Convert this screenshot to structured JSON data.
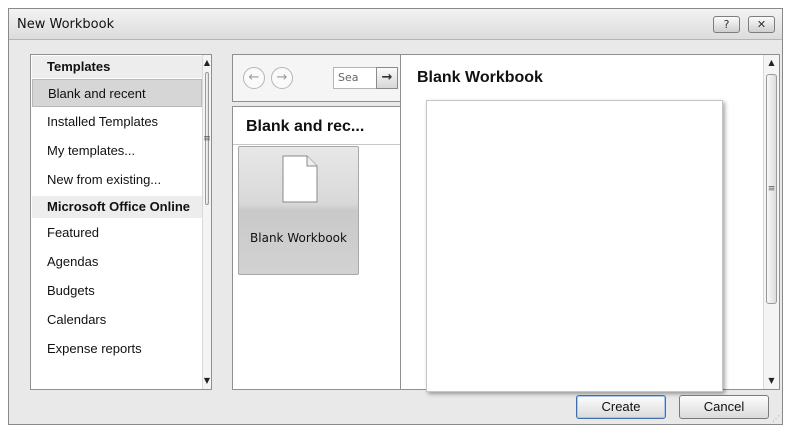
{
  "window": {
    "title": "New Workbook",
    "help_label": "?",
    "close_label": "✕"
  },
  "left_panel": {
    "items": [
      {
        "label": "Templates",
        "type": "header"
      },
      {
        "label": "Blank and recent",
        "type": "item",
        "selected": true
      },
      {
        "label": "Installed Templates",
        "type": "item"
      },
      {
        "label": "My templates...",
        "type": "item"
      },
      {
        "label": "New from existing...",
        "type": "item"
      },
      {
        "label": "Microsoft Office Online",
        "type": "header"
      },
      {
        "label": "Featured",
        "type": "item"
      },
      {
        "label": "Agendas",
        "type": "item"
      },
      {
        "label": "Budgets",
        "type": "item"
      },
      {
        "label": "Calendars",
        "type": "item"
      },
      {
        "label": "Expense reports",
        "type": "item"
      }
    ]
  },
  "nav": {
    "back_icon": "back-arrow-icon",
    "forward_icon": "forward-arrow-icon",
    "search_value": "Sea",
    "go_icon": "right-arrow-icon"
  },
  "middle_panel": {
    "header": "Blank and rec...",
    "template_label": "Blank Workbook"
  },
  "preview": {
    "title": "Blank Workbook"
  },
  "buttons": {
    "create": "Create",
    "cancel": "Cancel"
  },
  "scroll_icons": {
    "up": "▲",
    "down": "▼",
    "grip": "≡"
  }
}
